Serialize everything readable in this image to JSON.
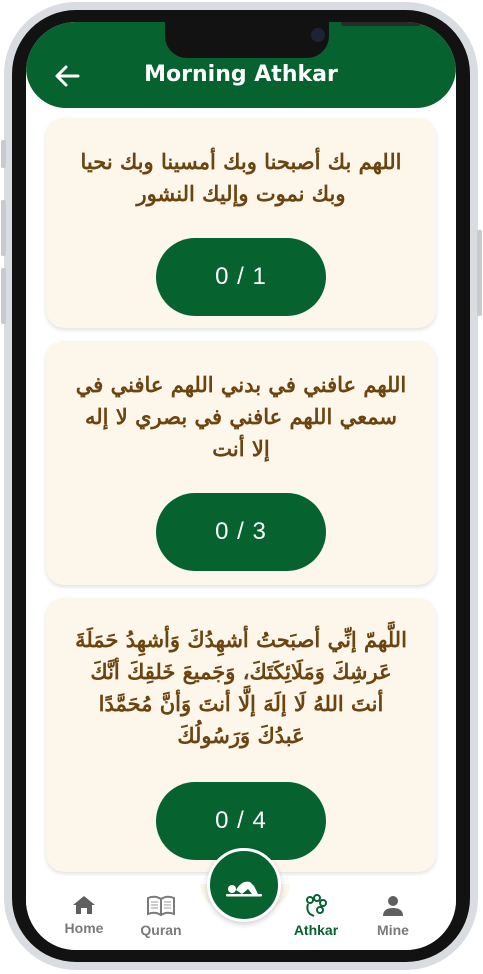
{
  "header": {
    "title": "Morning Athkar"
  },
  "athkar": [
    {
      "text": "اللهم بك أصبحنا وبك أمسينا وبك نحيا وبك نموت وإليك النشور",
      "count": "0 / 1"
    },
    {
      "text": "اللهم عافني في بدني اللهم عافني في سمعي اللهم عافني في بصري لا إله إلا أنت",
      "count": "0 / 3"
    },
    {
      "text": "اللَّهمّ إنِّي أصبَحتُ أشهِدُكَ وَأشهِدُ حَمَلَةَ عَرشِكَ وَمَلَائِكَتَكَ، وَجَميعَ خَلقِكَ أنَّكَ أنتَ اللهُ لَا إلَهَ إلَّا أنتَ وَأنَّ مُحَمَّدًا عَبدُكَ وَرَسُولُكَ",
      "count": "0 / 4"
    }
  ],
  "nav": {
    "home": "Home",
    "quran": "Quran",
    "athkar": "Athkar",
    "mine": "Mine"
  },
  "colors": {
    "primary": "#06632f",
    "card_bg": "#fdf6ea",
    "text_brown": "#6b4410"
  }
}
